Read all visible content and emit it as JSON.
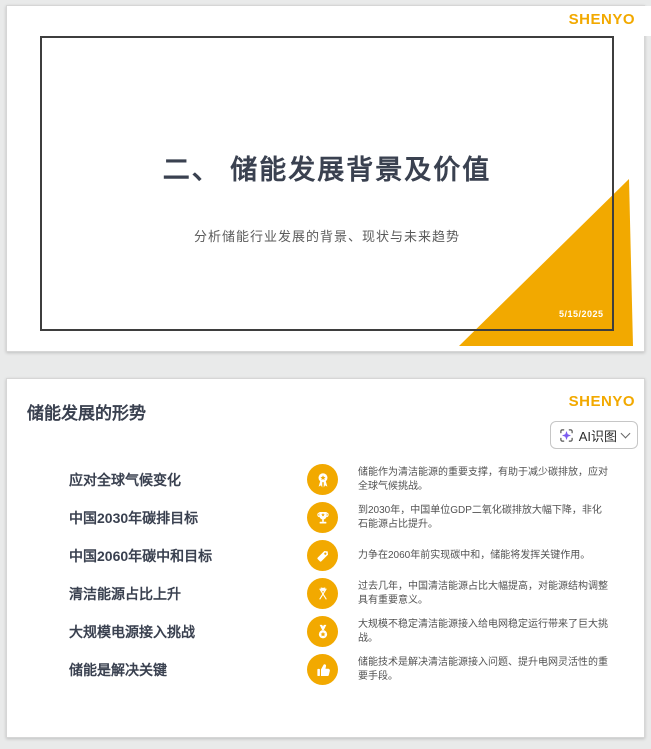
{
  "brand": {
    "name": "SHENYO",
    "color": "#F2A900"
  },
  "slide1": {
    "logo": "SHENYO",
    "title": "二、 储能发展背景及价值",
    "subtitle": "分析储能行业发展的背景、现状与未来趋势",
    "date": "5/15/2025",
    "accent_triangle_color": "#F2A900",
    "frame_border_color": "#3e3e3e"
  },
  "slide2": {
    "logo": "SHENYO",
    "title": "储能发展的形势",
    "ai_button": {
      "label": "AI识图",
      "icon": "ai-sparkle-scan-icon",
      "icon_color": "#7b5cf0",
      "chevron_icon": "chevron-down-icon"
    },
    "icon_circle_color": "#F2A900",
    "items": [
      {
        "label": "应对全球气候变化",
        "icon": "award-rosette-icon",
        "desc": "储能作为清洁能源的重要支撑，有助于减少碳排放，应对全球气候挑战。"
      },
      {
        "label": "中国2030年碳排目标",
        "icon": "trophy-icon",
        "desc": "到2030年，中国单位GDP二氧化碳排放大幅下降，非化石能源占比提升。"
      },
      {
        "label": "中国2060年碳中和目标",
        "icon": "price-tag-icon",
        "desc": "力争在2060年前实现碳中和，储能将发挥关键作用。"
      },
      {
        "label": "清洁能源占比上升",
        "icon": "crossed-flags-icon",
        "desc": "过去几年，中国清洁能源占比大幅提高，对能源结构调整具有重要意义。"
      },
      {
        "label": "大规模电源接入挑战",
        "icon": "medal-icon",
        "desc": "大规模不稳定清洁能源接入给电网稳定运行带来了巨大挑战。"
      },
      {
        "label": "储能是解决关键",
        "icon": "thumbs-up-icon",
        "desc": "储能技术是解决清洁能源接入问题、提升电网灵活性的重要手段。"
      }
    ]
  }
}
